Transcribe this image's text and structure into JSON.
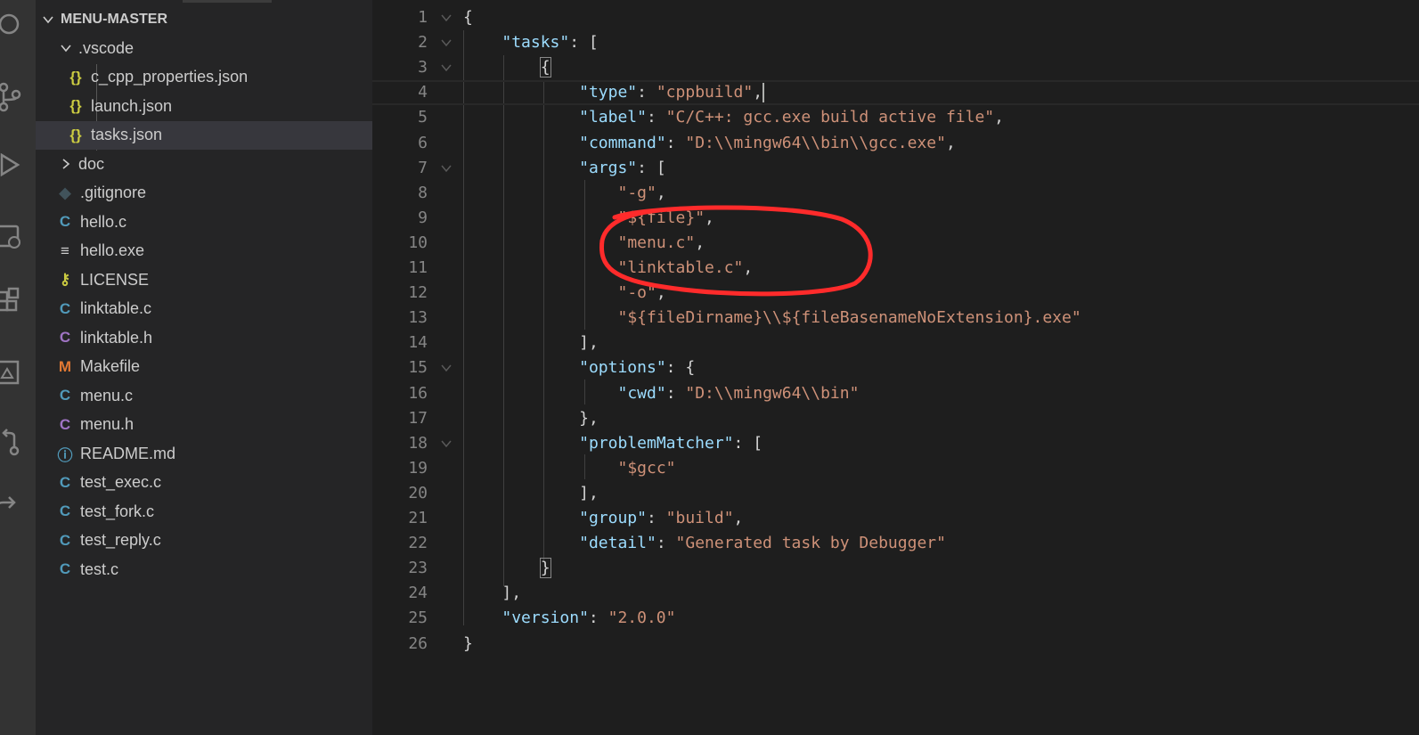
{
  "explorer": {
    "root_label": "MENU-MASTER",
    "items": [
      {
        "label": ".vscode",
        "icon": "folder-open-chevron",
        "icon_glyph": ""
      },
      {
        "label": "c_cpp_properties.json",
        "icon": "json-braces-icon",
        "icon_glyph": "{}",
        "icon_color": "#cbcb41"
      },
      {
        "label": "launch.json",
        "icon": "json-braces-icon",
        "icon_glyph": "{}",
        "icon_color": "#cbcb41"
      },
      {
        "label": "tasks.json",
        "icon": "json-braces-icon",
        "icon_glyph": "{}",
        "icon_color": "#cbcb41",
        "selected": true
      },
      {
        "label": "doc",
        "icon": "folder-closed-chevron",
        "icon_glyph": ""
      },
      {
        "label": ".gitignore",
        "icon": "git-icon",
        "icon_glyph": "◆",
        "icon_color": "#41535b"
      },
      {
        "label": "hello.c",
        "icon": "c-file-icon",
        "icon_glyph": "C",
        "icon_color": "#519aba"
      },
      {
        "label": "hello.exe",
        "icon": "text-file-icon",
        "icon_glyph": "≡",
        "icon_color": "#cccccc"
      },
      {
        "label": "LICENSE",
        "icon": "license-key-icon",
        "icon_glyph": "⚷",
        "icon_color": "#cbcb41"
      },
      {
        "label": "linktable.c",
        "icon": "c-file-icon",
        "icon_glyph": "C",
        "icon_color": "#519aba"
      },
      {
        "label": "linktable.h",
        "icon": "h-file-icon",
        "icon_glyph": "C",
        "icon_color": "#a074c4"
      },
      {
        "label": "Makefile",
        "icon": "makefile-icon",
        "icon_glyph": "M",
        "icon_color": "#e37933"
      },
      {
        "label": "menu.c",
        "icon": "c-file-icon",
        "icon_glyph": "C",
        "icon_color": "#519aba"
      },
      {
        "label": "menu.h",
        "icon": "h-file-icon",
        "icon_glyph": "C",
        "icon_color": "#a074c4"
      },
      {
        "label": "README.md",
        "icon": "info-icon",
        "icon_glyph": "ⓘ",
        "icon_color": "#519aba"
      },
      {
        "label": "test_exec.c",
        "icon": "c-file-icon",
        "icon_glyph": "C",
        "icon_color": "#519aba"
      },
      {
        "label": "test_fork.c",
        "icon": "c-file-icon",
        "icon_glyph": "C",
        "icon_color": "#519aba"
      },
      {
        "label": "test_reply.c",
        "icon": "c-file-icon",
        "icon_glyph": "C",
        "icon_color": "#519aba"
      },
      {
        "label": "test.c",
        "icon": "c-file-icon",
        "icon_glyph": "C",
        "icon_color": "#519aba"
      }
    ]
  },
  "editor": {
    "lines": [
      {
        "n": "1",
        "text": "{"
      },
      {
        "n": "2",
        "text": "    \"tasks\": ["
      },
      {
        "n": "3",
        "text": "        {"
      },
      {
        "n": "4",
        "text": "            \"type\": \"cppbuild\","
      },
      {
        "n": "5",
        "text": "            \"label\": \"C/C++: gcc.exe build active file\","
      },
      {
        "n": "6",
        "text": "            \"command\": \"D:\\\\mingw64\\\\bin\\\\gcc.exe\","
      },
      {
        "n": "7",
        "text": "            \"args\": ["
      },
      {
        "n": "8",
        "text": "                \"-g\","
      },
      {
        "n": "9",
        "text": "                \"${file}\","
      },
      {
        "n": "10",
        "text": "                \"menu.c\","
      },
      {
        "n": "11",
        "text": "                \"linktable.c\","
      },
      {
        "n": "12",
        "text": "                \"-o\","
      },
      {
        "n": "13",
        "text": "                \"${fileDirname}\\\\${fileBasenameNoExtension}.exe\""
      },
      {
        "n": "14",
        "text": "            ],"
      },
      {
        "n": "15",
        "text": "            \"options\": {"
      },
      {
        "n": "16",
        "text": "                \"cwd\": \"D:\\\\mingw64\\\\bin\""
      },
      {
        "n": "17",
        "text": "            },"
      },
      {
        "n": "18",
        "text": "            \"problemMatcher\": ["
      },
      {
        "n": "19",
        "text": "                \"$gcc\""
      },
      {
        "n": "20",
        "text": "            ],"
      },
      {
        "n": "21",
        "text": "            \"group\": \"build\","
      },
      {
        "n": "22",
        "text": "            \"detail\": \"Generated task by Debugger\""
      },
      {
        "n": "23",
        "text": "        }"
      },
      {
        "n": "24",
        "text": "    ],"
      },
      {
        "n": "25",
        "text": "    \"version\": \"2.0.0\""
      },
      {
        "n": "26",
        "text": "}"
      }
    ],
    "foldable_lines": [
      1,
      2,
      3,
      7,
      15,
      18
    ],
    "current_line": 4
  },
  "colors": {
    "key": "#9cdcfe",
    "string": "#ce9178",
    "punctuation": "#d4d4d4",
    "annotation": "#ff2b2b"
  },
  "activity_bar": [
    "search-icon",
    "source-control-icon",
    "run-debug-icon",
    "remote-explorer-icon",
    "extensions-icon",
    "testing-icon",
    "pull-request-icon",
    "live-share-icon"
  ]
}
